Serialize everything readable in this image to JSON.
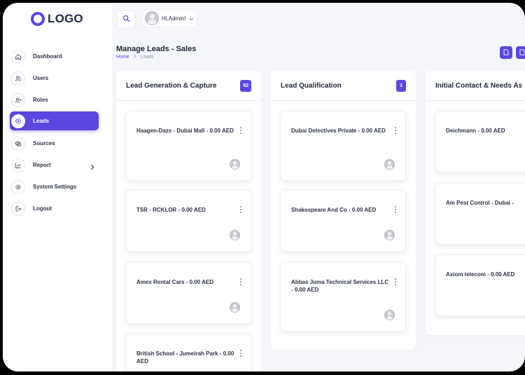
{
  "brand": {
    "logo_text": "LOGO",
    "accent": "#5b46e0"
  },
  "topbar": {
    "greeting": "Hi,Admin!",
    "search_icon": "search-icon",
    "user_dropdown_icon": "chevron-down-icon"
  },
  "sidebar": {
    "items": [
      {
        "label": "Dashboard",
        "icon": "home-icon"
      },
      {
        "label": "Users",
        "icon": "users-icon"
      },
      {
        "label": "Roles",
        "icon": "user-add-icon"
      },
      {
        "label": "Leads",
        "icon": "leads-icon",
        "active": true
      },
      {
        "label": "Sources",
        "icon": "sources-icon"
      },
      {
        "label": "Report",
        "icon": "chart-icon",
        "has_children": true
      },
      {
        "label": "System Settings",
        "icon": "gear-icon"
      },
      {
        "label": "Logout",
        "icon": "logout-icon"
      }
    ]
  },
  "page": {
    "title": "Manage Leads - Sales",
    "breadcrumb": {
      "home": "Home",
      "separator": ">",
      "current": "Leads"
    }
  },
  "columns": [
    {
      "title": "Lead Generation & Capture",
      "count": "92",
      "cards": [
        {
          "title": "Haagen-Dazs - Dubai Mall - 0.00 AED"
        },
        {
          "title": "TSR - RCKLOR - 0.00 AED"
        },
        {
          "title": "Amex Rental Cars - 0.00 AED"
        },
        {
          "title": "British School - Jumeirah Park - 0.00 AED"
        }
      ]
    },
    {
      "title": "Lead Qualification",
      "count": "3",
      "cards": [
        {
          "title": "Dubai Detectives Private - 0.00 AED"
        },
        {
          "title": "Shakespeare And Co - 0.00 AED"
        },
        {
          "title": "Abbas Juma Technical Services LLC - 0.00 AED"
        }
      ]
    },
    {
      "title": "Initial Contact & Needs As",
      "count": "",
      "cards": [
        {
          "title": "Deichmann - 0.00 AED"
        },
        {
          "title": "Am Pest Control - Dubai -"
        },
        {
          "title": "Axiom telecom - 0.00 AED"
        }
      ]
    }
  ]
}
